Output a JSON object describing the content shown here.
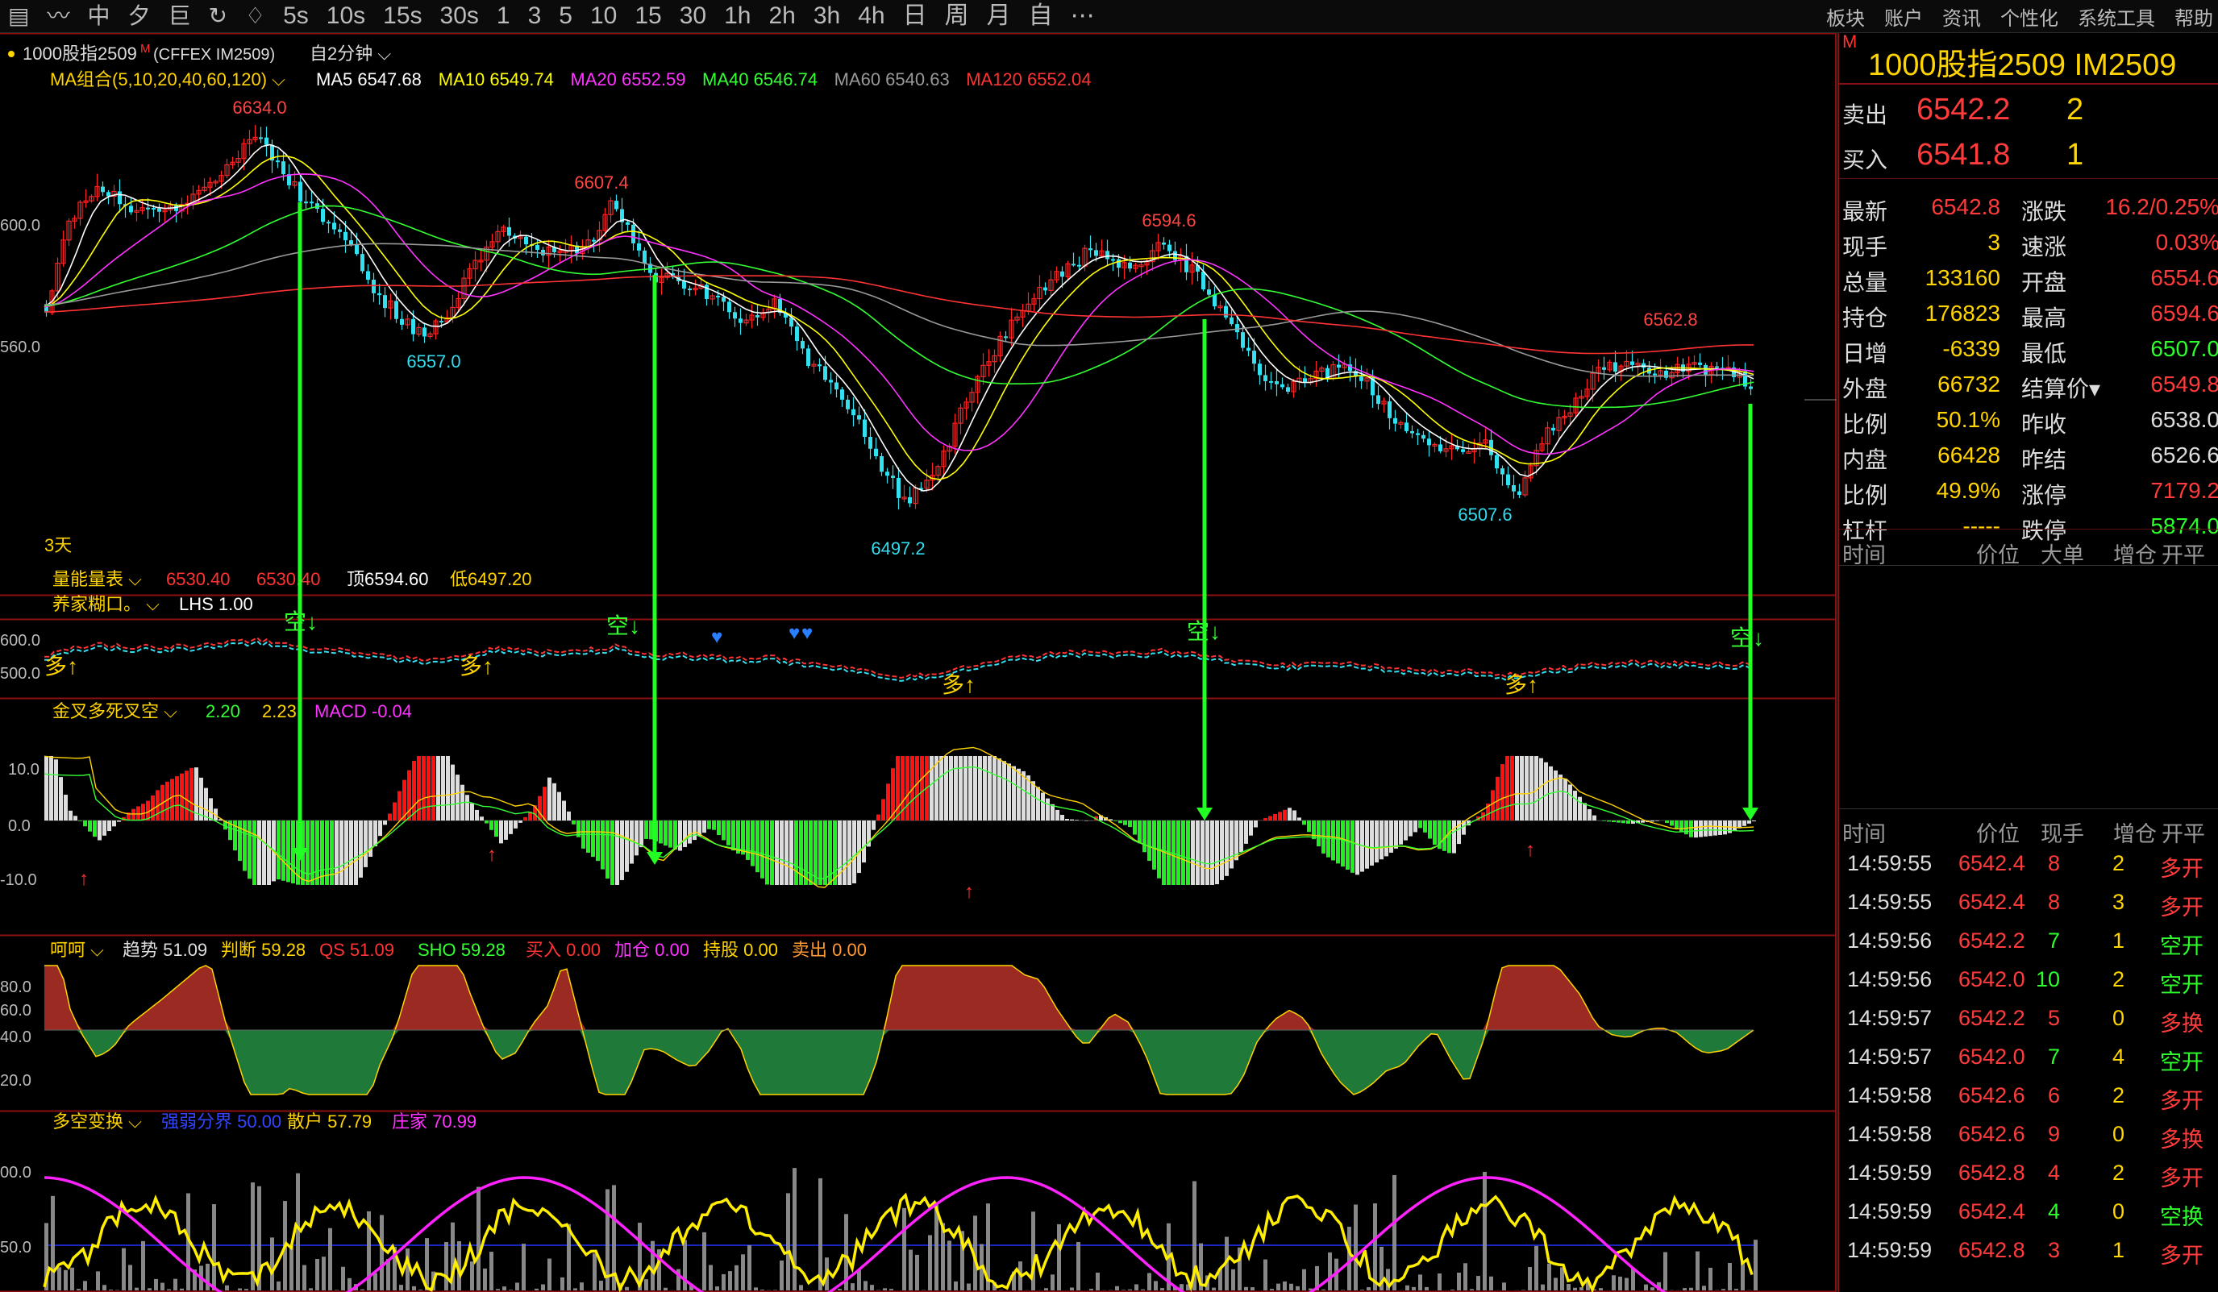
{
  "toolbar": {
    "items": [
      "▤",
      "〰",
      "中",
      "夕",
      "巨",
      "↻",
      "♢",
      "5s",
      "10s",
      "15s",
      "30s",
      "1",
      "3",
      "5",
      "10",
      "15",
      "30",
      "1h",
      "2h",
      "3h",
      "4h",
      "日",
      "周",
      "月",
      "自",
      "⋯"
    ],
    "menu": [
      "板块",
      "账户",
      "资讯",
      "个性化",
      "系统工具",
      "帮助"
    ]
  },
  "chart_header": {
    "symbol": "1000股指2509",
    "mark": "M",
    "exchange": "(CFFEX  IM2509)",
    "period": "自2分钟"
  },
  "ma": {
    "label": "MA组合(5,10,20,40,60,120)",
    "items": [
      {
        "text": "MA5 6547.68",
        "color": "#ffffff"
      },
      {
        "text": "MA10 6549.74",
        "color": "#ffff00"
      },
      {
        "text": "MA20 6552.59",
        "color": "#ff33ff"
      },
      {
        "text": "MA40 6546.74",
        "color": "#33ff33"
      },
      {
        "text": "MA60 6540.63",
        "color": "#999999"
      },
      {
        "text": "MA120 6552.04",
        "color": "#ff3333"
      }
    ]
  },
  "price_axis": [
    "600.0",
    "560.0"
  ],
  "extremes": [
    {
      "text": "6634.0",
      "color": "#ff4444"
    },
    {
      "text": "6557.0",
      "color": "#33ddee"
    },
    {
      "text": "6607.4",
      "color": "#ff4444"
    },
    {
      "text": "6497.2",
      "color": "#33ddee"
    },
    {
      "text": "6594.6",
      "color": "#ff4444"
    },
    {
      "text": "6507.6",
      "color": "#33ddee"
    },
    {
      "text": "6562.8",
      "color": "#ff4444"
    }
  ],
  "days_label": "3天",
  "sub1": {
    "title": "量能量表",
    "v1": "6530.40",
    "v2": "6530.40",
    "top_label": "顶",
    "top_val": "6594.60",
    "low_label": "低",
    "low_val": "6497.20"
  },
  "sub2": {
    "title": "养家糊口。",
    "lhs": "LHS 1.00",
    "axis": [
      "600.0",
      "500.0"
    ],
    "duo": "多↑",
    "kong": "空↓"
  },
  "sub3": {
    "title": "金叉多死叉空",
    "v1": "2.20",
    "v2": "2.23",
    "macd": "MACD -0.04",
    "axis": [
      "10.0",
      "0.0",
      "-10.0"
    ]
  },
  "sub4": {
    "title": "呵呵",
    "items": [
      {
        "text": "趋势 51.09",
        "color": "#dddddd"
      },
      {
        "text": "判断 59.28",
        "color": "#ffd400"
      },
      {
        "text": "QS 51.09",
        "color": "#ff3333"
      },
      {
        "text": "SHO 59.28",
        "color": "#33ff33"
      },
      {
        "text": "买入 0.00",
        "color": "#ff3333"
      },
      {
        "text": "加仓 0.00",
        "color": "#ff33ff"
      },
      {
        "text": "持股 0.00",
        "color": "#ffd400"
      },
      {
        "text": "卖出 0.00",
        "color": "#ff9933"
      }
    ],
    "axis": [
      "80.0",
      "60.0",
      "40.0",
      "20.0"
    ]
  },
  "sub5": {
    "title": "多空变换",
    "items": [
      {
        "text": "强弱分界 50.00",
        "color": "#3344ff"
      },
      {
        "text": "散户 57.79",
        "color": "#ffd400"
      },
      {
        "text": "庄家 70.99",
        "color": "#ff33ff"
      }
    ],
    "axis": [
      "00.0",
      "50.0"
    ]
  },
  "panel": {
    "mark": "M",
    "title": "1000股指2509  IM2509",
    "sell": {
      "label": "卖出",
      "price": "6542.2",
      "qty": "2"
    },
    "buy": {
      "label": "买入",
      "price": "6541.8",
      "qty": "1"
    },
    "stats": [
      {
        "l1": "最新",
        "v1": "6542.8",
        "c1": "#ff3b3b",
        "l2": "涨跌",
        "v2": "16.2/0.25%",
        "c2": "#ff3b3b"
      },
      {
        "l1": "现手",
        "v1": "3",
        "c1": "#ffd400",
        "l2": "速涨",
        "v2": "0.03%",
        "c2": "#ff3b3b"
      },
      {
        "l1": "总量",
        "v1": "133160",
        "c1": "#ffd400",
        "l2": "开盘",
        "v2": "6554.6",
        "c2": "#ff3b3b"
      },
      {
        "l1": "持仓",
        "v1": "176823",
        "c1": "#ffd400",
        "l2": "最高",
        "v2": "6594.6",
        "c2": "#ff3b3b"
      },
      {
        "l1": "日增",
        "v1": "-6339",
        "c1": "#ffd400",
        "l2": "最低",
        "v2": "6507.0",
        "c2": "#2cff2c"
      },
      {
        "l1": "外盘",
        "v1": "66732",
        "c1": "#ffd400",
        "l2": "结算价▾",
        "v2": "6549.8",
        "c2": "#ff3b3b"
      },
      {
        "l1": "比例",
        "v1": "50.1%",
        "c1": "#ffd400",
        "l2": "昨收",
        "v2": "6538.0",
        "c2": "#dddddd"
      },
      {
        "l1": "内盘",
        "v1": "66428",
        "c1": "#ffd400",
        "l2": "昨结",
        "v2": "6526.6",
        "c2": "#dddddd"
      },
      {
        "l1": "比例",
        "v1": "49.9%",
        "c1": "#ffd400",
        "l2": "涨停",
        "v2": "7179.2",
        "c2": "#ff3b3b"
      },
      {
        "l1": "杠杆",
        "v1": "-----",
        "c1": "#ffd400",
        "l2": "跌停",
        "v2": "5874.0",
        "c2": "#2cff2c"
      }
    ],
    "header1": [
      "时间",
      "价位",
      "大单",
      "增仓",
      "开平"
    ],
    "header2": [
      "时间",
      "价位",
      "现手",
      "增仓",
      "开平"
    ],
    "trades": [
      {
        "time": "14:59:55",
        "price": "6542.4",
        "qty": "8",
        "oi": "2",
        "type": "多开",
        "pc": "#ff3b3b",
        "tc": "#ff3b3b",
        "qc": "#ff3b3b"
      },
      {
        "time": "14:59:55",
        "price": "6542.4",
        "qty": "8",
        "oi": "3",
        "type": "多开",
        "pc": "#ff3b3b",
        "tc": "#ff3b3b",
        "qc": "#ff3b3b"
      },
      {
        "time": "14:59:56",
        "price": "6542.2",
        "qty": "7",
        "oi": "1",
        "type": "空开",
        "pc": "#ff3b3b",
        "tc": "#2cff2c",
        "qc": "#2cff2c"
      },
      {
        "time": "14:59:56",
        "price": "6542.0",
        "qty": "10",
        "oi": "2",
        "type": "空开",
        "pc": "#ff3b3b",
        "tc": "#2cff2c",
        "qc": "#2cff2c"
      },
      {
        "time": "14:59:57",
        "price": "6542.2",
        "qty": "5",
        "oi": "0",
        "type": "多换",
        "pc": "#ff3b3b",
        "tc": "#ff3b3b",
        "qc": "#ff3b3b"
      },
      {
        "time": "14:59:57",
        "price": "6542.0",
        "qty": "7",
        "oi": "4",
        "type": "空开",
        "pc": "#ff3b3b",
        "tc": "#2cff2c",
        "qc": "#2cff2c"
      },
      {
        "time": "14:59:58",
        "price": "6542.6",
        "qty": "6",
        "oi": "2",
        "type": "多开",
        "pc": "#ff3b3b",
        "tc": "#ff3b3b",
        "qc": "#ff3b3b"
      },
      {
        "time": "14:59:58",
        "price": "6542.6",
        "qty": "9",
        "oi": "0",
        "type": "多换",
        "pc": "#ff3b3b",
        "tc": "#ff3b3b",
        "qc": "#ff3b3b"
      },
      {
        "time": "14:59:59",
        "price": "6542.8",
        "qty": "4",
        "oi": "2",
        "type": "多开",
        "pc": "#ff3b3b",
        "tc": "#ff3b3b",
        "qc": "#ff3b3b"
      },
      {
        "time": "14:59:59",
        "price": "6542.4",
        "qty": "4",
        "oi": "0",
        "type": "空换",
        "pc": "#ff3b3b",
        "tc": "#2cff2c",
        "qc": "#2cff2c"
      },
      {
        "time": "14:59:59",
        "price": "6542.8",
        "qty": "3",
        "oi": "1",
        "type": "多开",
        "pc": "#ff3b3b",
        "tc": "#ff3b3b",
        "qc": "#ff3b3b"
      }
    ]
  },
  "colors": {
    "up": "#ff2222",
    "down": "#33e0f0",
    "panel_border": "#8b1010",
    "signal_arrow": "#22ff22"
  }
}
